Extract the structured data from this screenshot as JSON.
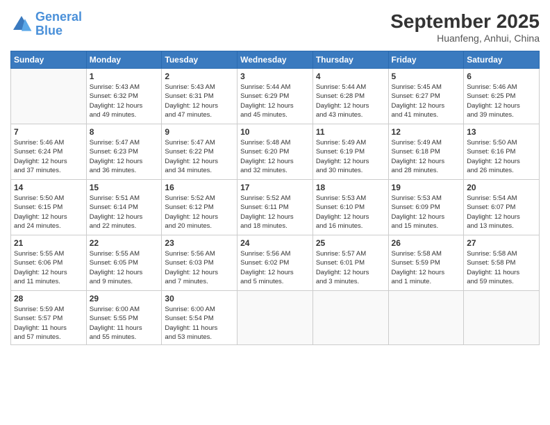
{
  "header": {
    "logo_line1": "General",
    "logo_line2": "Blue",
    "month": "September 2025",
    "location": "Huanfeng, Anhui, China"
  },
  "days_of_week": [
    "Sunday",
    "Monday",
    "Tuesday",
    "Wednesday",
    "Thursday",
    "Friday",
    "Saturday"
  ],
  "weeks": [
    [
      {
        "num": "",
        "info": ""
      },
      {
        "num": "1",
        "info": "Sunrise: 5:43 AM\nSunset: 6:32 PM\nDaylight: 12 hours\nand 49 minutes."
      },
      {
        "num": "2",
        "info": "Sunrise: 5:43 AM\nSunset: 6:31 PM\nDaylight: 12 hours\nand 47 minutes."
      },
      {
        "num": "3",
        "info": "Sunrise: 5:44 AM\nSunset: 6:29 PM\nDaylight: 12 hours\nand 45 minutes."
      },
      {
        "num": "4",
        "info": "Sunrise: 5:44 AM\nSunset: 6:28 PM\nDaylight: 12 hours\nand 43 minutes."
      },
      {
        "num": "5",
        "info": "Sunrise: 5:45 AM\nSunset: 6:27 PM\nDaylight: 12 hours\nand 41 minutes."
      },
      {
        "num": "6",
        "info": "Sunrise: 5:46 AM\nSunset: 6:25 PM\nDaylight: 12 hours\nand 39 minutes."
      }
    ],
    [
      {
        "num": "7",
        "info": "Sunrise: 5:46 AM\nSunset: 6:24 PM\nDaylight: 12 hours\nand 37 minutes."
      },
      {
        "num": "8",
        "info": "Sunrise: 5:47 AM\nSunset: 6:23 PM\nDaylight: 12 hours\nand 36 minutes."
      },
      {
        "num": "9",
        "info": "Sunrise: 5:47 AM\nSunset: 6:22 PM\nDaylight: 12 hours\nand 34 minutes."
      },
      {
        "num": "10",
        "info": "Sunrise: 5:48 AM\nSunset: 6:20 PM\nDaylight: 12 hours\nand 32 minutes."
      },
      {
        "num": "11",
        "info": "Sunrise: 5:49 AM\nSunset: 6:19 PM\nDaylight: 12 hours\nand 30 minutes."
      },
      {
        "num": "12",
        "info": "Sunrise: 5:49 AM\nSunset: 6:18 PM\nDaylight: 12 hours\nand 28 minutes."
      },
      {
        "num": "13",
        "info": "Sunrise: 5:50 AM\nSunset: 6:16 PM\nDaylight: 12 hours\nand 26 minutes."
      }
    ],
    [
      {
        "num": "14",
        "info": "Sunrise: 5:50 AM\nSunset: 6:15 PM\nDaylight: 12 hours\nand 24 minutes."
      },
      {
        "num": "15",
        "info": "Sunrise: 5:51 AM\nSunset: 6:14 PM\nDaylight: 12 hours\nand 22 minutes."
      },
      {
        "num": "16",
        "info": "Sunrise: 5:52 AM\nSunset: 6:12 PM\nDaylight: 12 hours\nand 20 minutes."
      },
      {
        "num": "17",
        "info": "Sunrise: 5:52 AM\nSunset: 6:11 PM\nDaylight: 12 hours\nand 18 minutes."
      },
      {
        "num": "18",
        "info": "Sunrise: 5:53 AM\nSunset: 6:10 PM\nDaylight: 12 hours\nand 16 minutes."
      },
      {
        "num": "19",
        "info": "Sunrise: 5:53 AM\nSunset: 6:09 PM\nDaylight: 12 hours\nand 15 minutes."
      },
      {
        "num": "20",
        "info": "Sunrise: 5:54 AM\nSunset: 6:07 PM\nDaylight: 12 hours\nand 13 minutes."
      }
    ],
    [
      {
        "num": "21",
        "info": "Sunrise: 5:55 AM\nSunset: 6:06 PM\nDaylight: 12 hours\nand 11 minutes."
      },
      {
        "num": "22",
        "info": "Sunrise: 5:55 AM\nSunset: 6:05 PM\nDaylight: 12 hours\nand 9 minutes."
      },
      {
        "num": "23",
        "info": "Sunrise: 5:56 AM\nSunset: 6:03 PM\nDaylight: 12 hours\nand 7 minutes."
      },
      {
        "num": "24",
        "info": "Sunrise: 5:56 AM\nSunset: 6:02 PM\nDaylight: 12 hours\nand 5 minutes."
      },
      {
        "num": "25",
        "info": "Sunrise: 5:57 AM\nSunset: 6:01 PM\nDaylight: 12 hours\nand 3 minutes."
      },
      {
        "num": "26",
        "info": "Sunrise: 5:58 AM\nSunset: 5:59 PM\nDaylight: 12 hours\nand 1 minute."
      },
      {
        "num": "27",
        "info": "Sunrise: 5:58 AM\nSunset: 5:58 PM\nDaylight: 11 hours\nand 59 minutes."
      }
    ],
    [
      {
        "num": "28",
        "info": "Sunrise: 5:59 AM\nSunset: 5:57 PM\nDaylight: 11 hours\nand 57 minutes."
      },
      {
        "num": "29",
        "info": "Sunrise: 6:00 AM\nSunset: 5:55 PM\nDaylight: 11 hours\nand 55 minutes."
      },
      {
        "num": "30",
        "info": "Sunrise: 6:00 AM\nSunset: 5:54 PM\nDaylight: 11 hours\nand 53 minutes."
      },
      {
        "num": "",
        "info": ""
      },
      {
        "num": "",
        "info": ""
      },
      {
        "num": "",
        "info": ""
      },
      {
        "num": "",
        "info": ""
      }
    ]
  ]
}
